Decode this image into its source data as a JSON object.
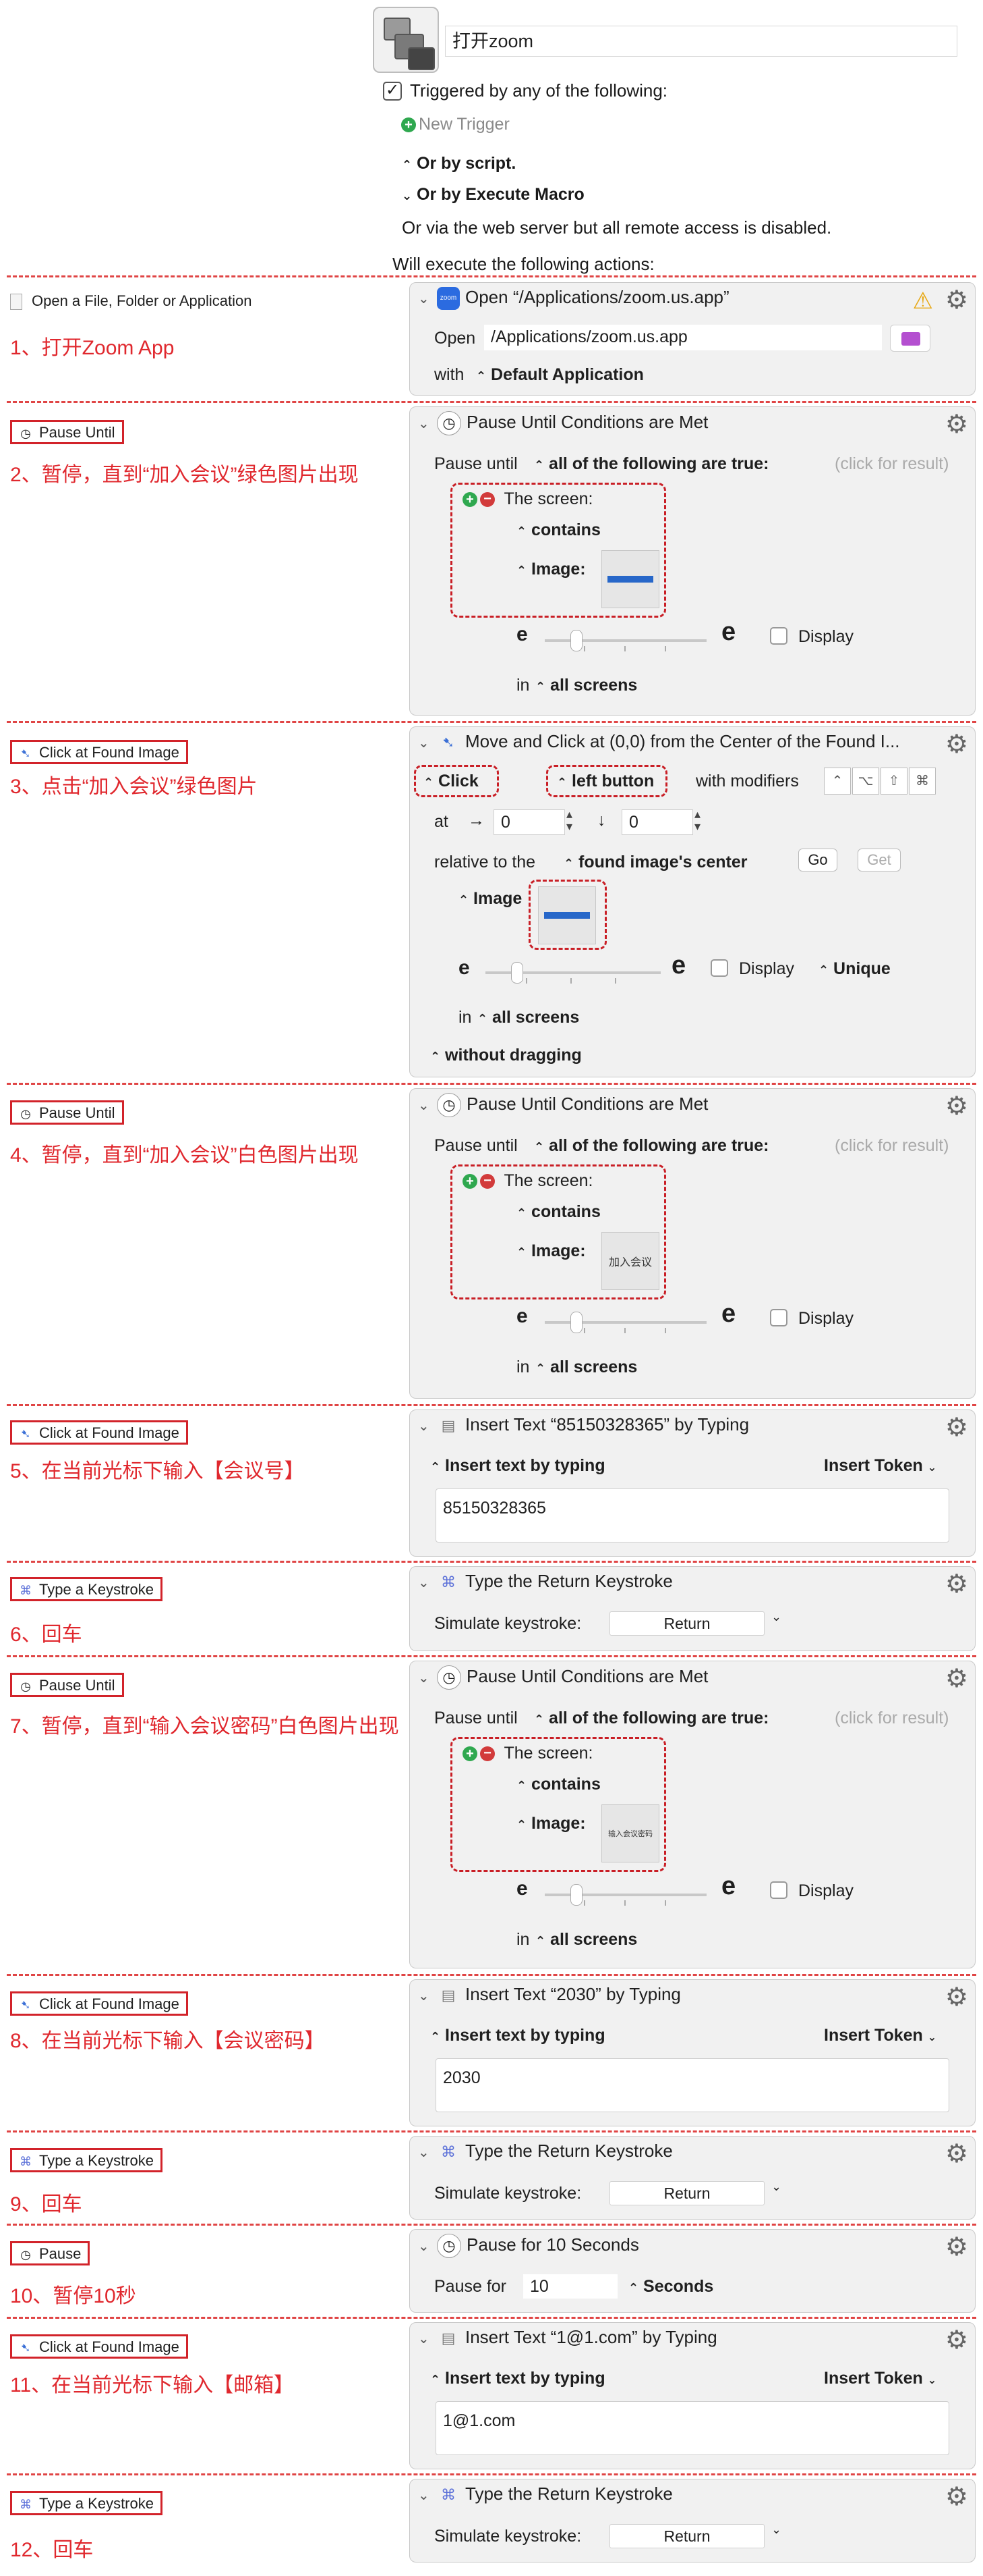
{
  "header": {
    "macro_name": "打开zoom",
    "trigger_checkbox": "✓",
    "triggered_by": "Triggered by any of the following:",
    "new_trigger": "New Trigger",
    "by_script": "Or by script.",
    "by_execute_macro": "Or by Execute Macro",
    "web_server": "Or via the web server but all remote access is disabled.",
    "will_execute": "Will execute the following actions:"
  },
  "steps": [
    {
      "label": "Open a File, Folder or Application",
      "caption": "1、打开Zoom App"
    },
    {
      "label": "Pause Until",
      "caption": "2、暂停，直到“加入会议”绿色图片出现"
    },
    {
      "label": "Click at Found Image",
      "caption": "3、点击“加入会议”绿色图片"
    },
    {
      "label": "Pause Until",
      "caption": "4、暂停，直到“加入会议”白色图片出现"
    },
    {
      "label": "Click at Found Image",
      "caption": "5、在当前光标下输入【会议号】"
    },
    {
      "label": "Type a Keystroke",
      "caption": "6、回车"
    },
    {
      "label": "Pause Until",
      "caption": "7、暂停，直到“输入会议密码”白色图片出现"
    },
    {
      "label": "Click at Found Image",
      "caption": "8、在当前光标下输入【会议密码】"
    },
    {
      "label": "Type a Keystroke",
      "caption": "9、回车"
    },
    {
      "label": "Pause",
      "caption": "10、暂停10秒"
    },
    {
      "label": "Click at Found Image",
      "caption": "11、在当前光标下输入【邮箱】"
    },
    {
      "label": "Type a Keystroke",
      "caption": "12、回车"
    }
  ],
  "open_action": {
    "title": "Open “/Applications/zoom.us.app”",
    "open_label": "Open",
    "path": "/Applications/zoom.us.app",
    "with_label": "with",
    "with_value": "Default Application",
    "app_icon_text": "zoom"
  },
  "pause_until": {
    "title": "Pause Until Conditions are Met",
    "pause_until_label": "Pause until",
    "all_following": "all of the following are true:",
    "click_for_result": "(click for result)",
    "the_screen": "The screen:",
    "contains": "contains",
    "image_label": "Image:",
    "display_label": "Display",
    "in_label": "in",
    "all_screens": "all screens",
    "e_letter": "e"
  },
  "click_action": {
    "title": "Move and Click at (0,0) from the Center of the Found I...",
    "click": "Click",
    "left_button": "left button",
    "with_modifiers": "with modifiers",
    "modifiers": [
      "⌃",
      "⌥",
      "⇧",
      "⌘"
    ],
    "at_label": "at",
    "x_arrow": "→",
    "x_value": "0",
    "y_arrow": "↓",
    "y_value": "0",
    "relative_label": "relative to the",
    "relative_value": "found image's center",
    "go_label": "Go",
    "get_label": "Get",
    "image_label": "Image",
    "display_label": "Display",
    "unique_label": "Unique",
    "in_label": "in",
    "all_screens": "all screens",
    "without_dragging": "without dragging"
  },
  "thumb_texts": {
    "white_join": "加入会议",
    "white_password": "输入会议密码"
  },
  "insert_text_1": {
    "title": "Insert Text “85150328365” by Typing",
    "mode": "Insert text by typing",
    "insert_token": "Insert Token",
    "text": "85150328365"
  },
  "insert_text_2": {
    "title": "Insert Text “2030” by Typing",
    "mode": "Insert text by typing",
    "insert_token": "Insert Token",
    "text": "2030"
  },
  "insert_text_3": {
    "title": "Insert Text “1@1.com” by Typing",
    "mode": "Insert text by typing",
    "insert_token": "Insert Token",
    "text": "1@1.com"
  },
  "keystroke": {
    "title": "Type the Return Keystroke",
    "simulate_label": "Simulate keystroke:",
    "key": "Return"
  },
  "pause_action": {
    "title": "Pause for 10 Seconds",
    "pause_for_label": "Pause for",
    "value": "10",
    "unit": "Seconds"
  },
  "colors": {
    "annotation_red": "#e0282e",
    "panel_bg": "#f1f1f1",
    "accent_blue": "#2767c9"
  }
}
